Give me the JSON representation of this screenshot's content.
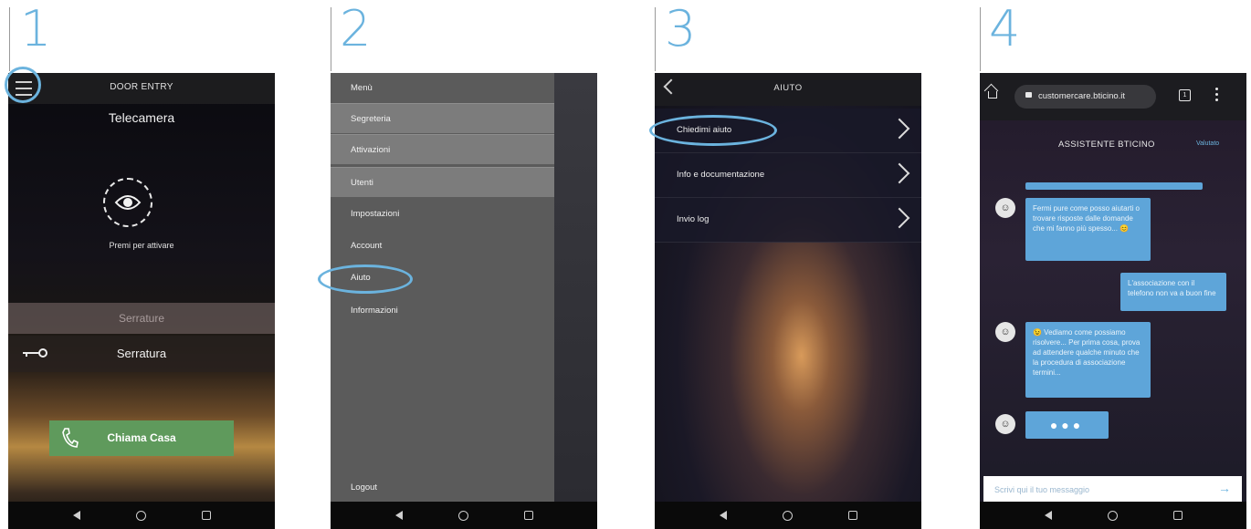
{
  "steps": [
    "1",
    "2",
    "3",
    "4"
  ],
  "colors": {
    "accent": "#6bb3de",
    "call_green": "#5f9a5c",
    "bubble_blue": "#5ea5d9"
  },
  "phone1": {
    "header_title": "DOOR ENTRY",
    "subtitle": "Telecamera",
    "activate_label": "Premi per attivare",
    "locks_header": "Serrature",
    "lock_label": "Serratura",
    "call_button": "Chiama Casa",
    "icons": [
      "menu-icon",
      "eye-icon",
      "key-icon",
      "phone-icon"
    ]
  },
  "phone2": {
    "menu_title": "Menù",
    "items": [
      "Segreteria",
      "Attivazioni",
      "Utenti",
      "Impostazioni",
      "Account",
      "Aiuto",
      "Informazioni"
    ],
    "logout": "Logout"
  },
  "phone3": {
    "header_title": "AIUTO",
    "rows": [
      "Chiedimi aiuto",
      "Info e documentazione",
      "Invio log"
    ]
  },
  "phone4": {
    "url": "customercare.bticino.it",
    "tab_count": "1",
    "chat_title": "ASSISTENTE BTICINO",
    "lang_link": "Valutato",
    "bot_msg_1": "Fermi pure come posso aiutarti o trovare risposte dalle domande che mi fanno più spesso... 😊",
    "user_msg": "L'associazione con il telefono non va a buon fine",
    "bot_msg_2": "😉 Vediamo come possiamo risolvere... Per prima cosa, prova ad attendere qualche minuto che la procedura di associazione termini...",
    "input_placeholder": "Scrivi qui il tuo messaggio"
  }
}
